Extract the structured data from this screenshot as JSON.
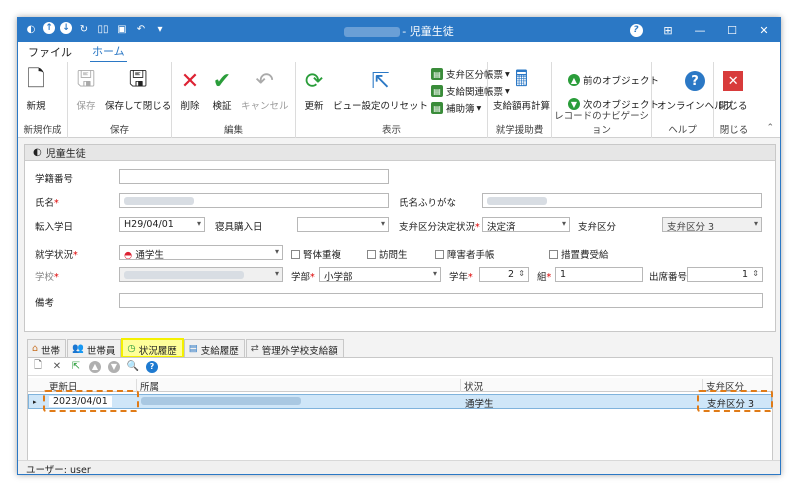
{
  "window": {
    "title": "- 児童生徒",
    "minimize": "—",
    "restore": "☐",
    "close": "✕"
  },
  "ribbon_tabs": [
    "ファイル",
    "ホーム"
  ],
  "ribbon": {
    "new_label": "新規",
    "group_new": "新規作成",
    "save_label": "保存",
    "save_close_label": "保存して閉じる",
    "group_save": "保存",
    "delete_label": "削除",
    "verify_label": "検証",
    "cancel_label": "キャンセル",
    "group_edit": "編集",
    "refresh_label": "更新",
    "view_reset_label": "ビュー設定のリセット",
    "shiben_report_label": "支弁区分帳票",
    "shikyu_report_label": "支給関連帳票",
    "hojo_label": "補助簿",
    "group_display": "表示",
    "recalc_label": "支給額再計算",
    "group_shugaku": "就学援助費",
    "prev_label": "前のオブジェクト",
    "next_label": "次のオブジェクト",
    "group_nav": "レコードのナビゲーション",
    "online_help_label": "オンラインヘルプ",
    "group_help": "ヘルプ",
    "close_label": "閉じる",
    "group_close": "閉じる"
  },
  "form": {
    "header": "児童生徒",
    "gakuseki_label": "学籍番号",
    "gakuseki_value": "",
    "name_label": "氏名",
    "furigana_label": "氏名ふりがな",
    "tennyu_label": "転入学日",
    "tennyu_value": "H29/04/01",
    "shingu_label": "寝具購入日",
    "shingu_value": "",
    "shiben_status_label": "支弁区分決定状況",
    "shiben_status_value": "決定済",
    "shiben_label": "支弁区分",
    "shiben_value": "支弁区分 3",
    "shugaku_label": "就学状況",
    "shugaku_value": "通学生",
    "cb_jintai": "腎体重複",
    "cb_homon": "訪問生",
    "cb_shogai": "障害者手帳",
    "cb_sochi": "措置費受給",
    "school_label": "学校",
    "bu_label": "学部",
    "bu_value": "小学部",
    "nen_label": "学年",
    "nen_value": "2",
    "kumi_label": "組",
    "kumi_value": "1",
    "shusseki_label": "出席番号",
    "shusseki_value": "1",
    "biko_label": "備考",
    "biko_value": ""
  },
  "tabs": [
    "世帯",
    "世帯員",
    "状況履歴",
    "支給履歴",
    "管理外学校支給額"
  ],
  "grid": {
    "columns": [
      "更新日",
      "所属",
      "状況",
      "支弁区分"
    ],
    "rows": [
      {
        "date": "2023/04/01",
        "shozoku": "",
        "status": "通学生",
        "shiben": "支弁区分 3"
      }
    ]
  },
  "status_bar": "ユーザー: user",
  "colors": {
    "titlebar": "#2b78c5",
    "highlight_yellow": "#f4f000",
    "dash_orange": "#e07b17",
    "selected_row": "#cfe6f8"
  }
}
